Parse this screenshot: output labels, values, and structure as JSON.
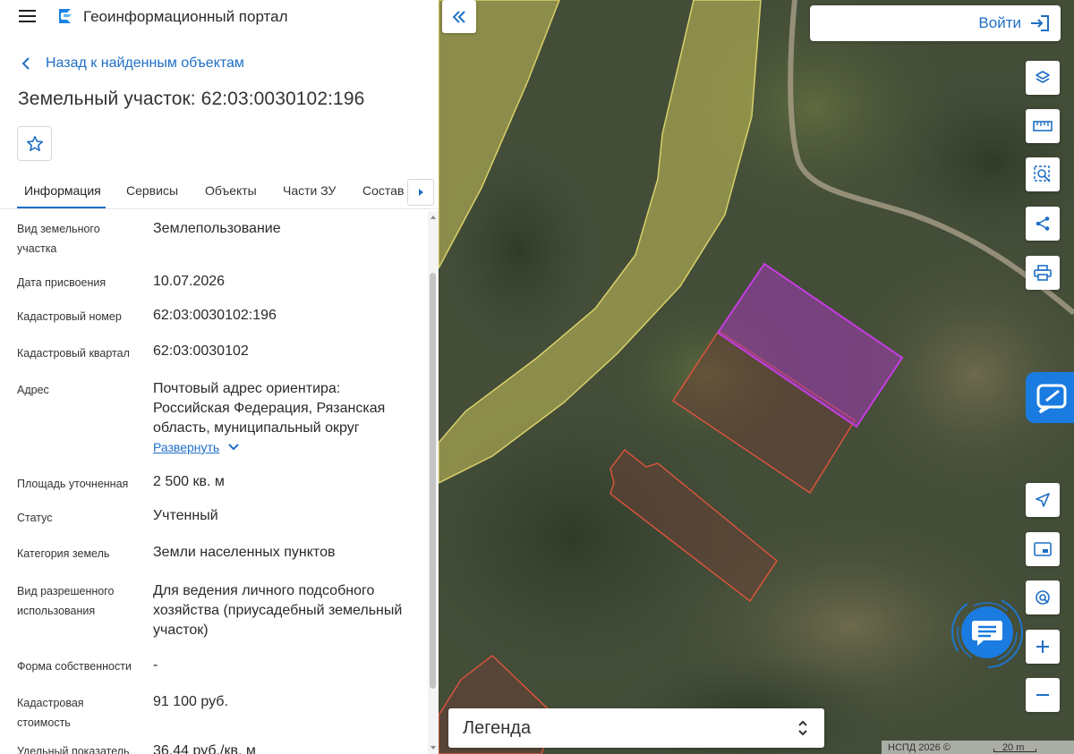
{
  "app": {
    "title": "Геоинформационный портал",
    "back_label": "Назад к найденным объектам",
    "object_title": "Земельный участок: 62:03:0030102:196"
  },
  "tabs": [
    {
      "label": "Информация",
      "active": true
    },
    {
      "label": "Сервисы"
    },
    {
      "label": "Объекты"
    },
    {
      "label": "Части ЗУ"
    },
    {
      "label": "Состав"
    }
  ],
  "info": [
    {
      "label": "Вид земельного участка",
      "value": "Землепользование"
    },
    {
      "label": "Дата присвоения",
      "value": "10.07.2026"
    },
    {
      "label": "Кадастровый номер",
      "value": "62:03:0030102:196"
    },
    {
      "label": "Кадастровый квартал",
      "value": "62:03:0030102"
    },
    {
      "label": "Адрес",
      "value": "Почтовый адрес ориентира: Российская Федерация, Рязанская область, муниципальный округ"
    },
    {
      "label": "Площадь уточненная",
      "value": "2 500 кв. м"
    },
    {
      "label": "Статус",
      "value": "Учтенный"
    },
    {
      "label": "Категория земель",
      "value": "Земли населенных пунктов"
    },
    {
      "label": "Вид разрешенного использования",
      "value": "Для ведения личного подсобного хозяйства (приусадебный земельный участок)"
    },
    {
      "label": "Форма собственности",
      "value": "-"
    },
    {
      "label": "Кадастровая стоимость",
      "value": "91 100 руб."
    },
    {
      "label": "Удельный показатель",
      "value": "36,44 руб./кв. м"
    }
  ],
  "expand_label": "Развернуть",
  "map": {
    "login_label": "Войти",
    "legend_label": "Легенда",
    "attribution": "НСПД 2026 ©",
    "scale_label": "20 m",
    "tools": [
      "layers-icon",
      "ruler-icon",
      "select-area-icon",
      "share-icon",
      "print-icon",
      "locate-icon",
      "minimap-icon",
      "location-search-icon",
      "zoom-in-icon",
      "zoom-out-icon"
    ]
  },
  "colors": {
    "accent": "#1f6fc5",
    "selected_parcel": "#b02cc8",
    "parcel_outline": "#e0553a",
    "zone_fill": "#c9c25a"
  }
}
